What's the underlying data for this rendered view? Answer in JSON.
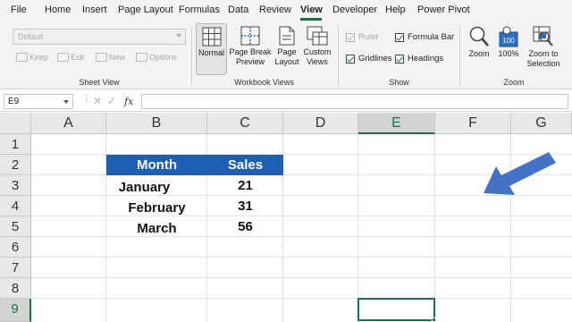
{
  "menu": {
    "tabs": [
      "File",
      "Home",
      "Insert",
      "Page Layout",
      "Formulas",
      "Data",
      "Review",
      "View",
      "Developer",
      "Help",
      "Power Pivot"
    ],
    "active_tab": "View"
  },
  "ribbon": {
    "sheet_view": {
      "dropdown_value": "Default",
      "buttons": [
        "Keep",
        "Exit",
        "New",
        "Options"
      ],
      "group_label": "Sheet View"
    },
    "workbook_views": {
      "buttons": [
        {
          "line1": "Normal",
          "line2": ""
        },
        {
          "line1": "Page Break",
          "line2": "Preview"
        },
        {
          "line1": "Page",
          "line2": "Layout"
        },
        {
          "line1": "Custom",
          "line2": "Views"
        }
      ],
      "selected": "Normal",
      "group_label": "Workbook Views"
    },
    "show": {
      "checkboxes": [
        {
          "label": "Ruler",
          "checked": true,
          "disabled": true
        },
        {
          "label": "Formula Bar",
          "checked": true,
          "disabled": false
        },
        {
          "label": "Gridlines",
          "checked": true,
          "disabled": false
        },
        {
          "label": "Headings",
          "checked": true,
          "disabled": false
        }
      ],
      "group_label": "Show"
    },
    "zoom": {
      "buttons": [
        {
          "line1": "Zoom",
          "line2": ""
        },
        {
          "line1": "100%",
          "line2": ""
        },
        {
          "line1": "Zoom to",
          "line2": "Selection"
        }
      ],
      "icon_100_text": "100",
      "group_label": "Zoom"
    }
  },
  "formula_bar": {
    "name_box": "E9",
    "cancel_icon": "✕",
    "enter_icon": "✓",
    "fx_label": "fx",
    "formula": ""
  },
  "sheet": {
    "columns": [
      "A",
      "B",
      "C",
      "D",
      "E",
      "F",
      "G"
    ],
    "rows": [
      "1",
      "2",
      "3",
      "4",
      "5",
      "6",
      "7",
      "8",
      "9"
    ],
    "selected_cell": "E9",
    "table": {
      "headers": [
        "Month",
        "Sales"
      ],
      "rows": [
        [
          "January",
          "21"
        ],
        [
          "February",
          "31"
        ],
        [
          "March",
          "56"
        ]
      ]
    },
    "header_fill": "#1f5fb3",
    "arrow_color": "#4472c4"
  },
  "colors": {
    "accent": "#1e7145",
    "ribbon_bg": "#f3f3f3"
  }
}
